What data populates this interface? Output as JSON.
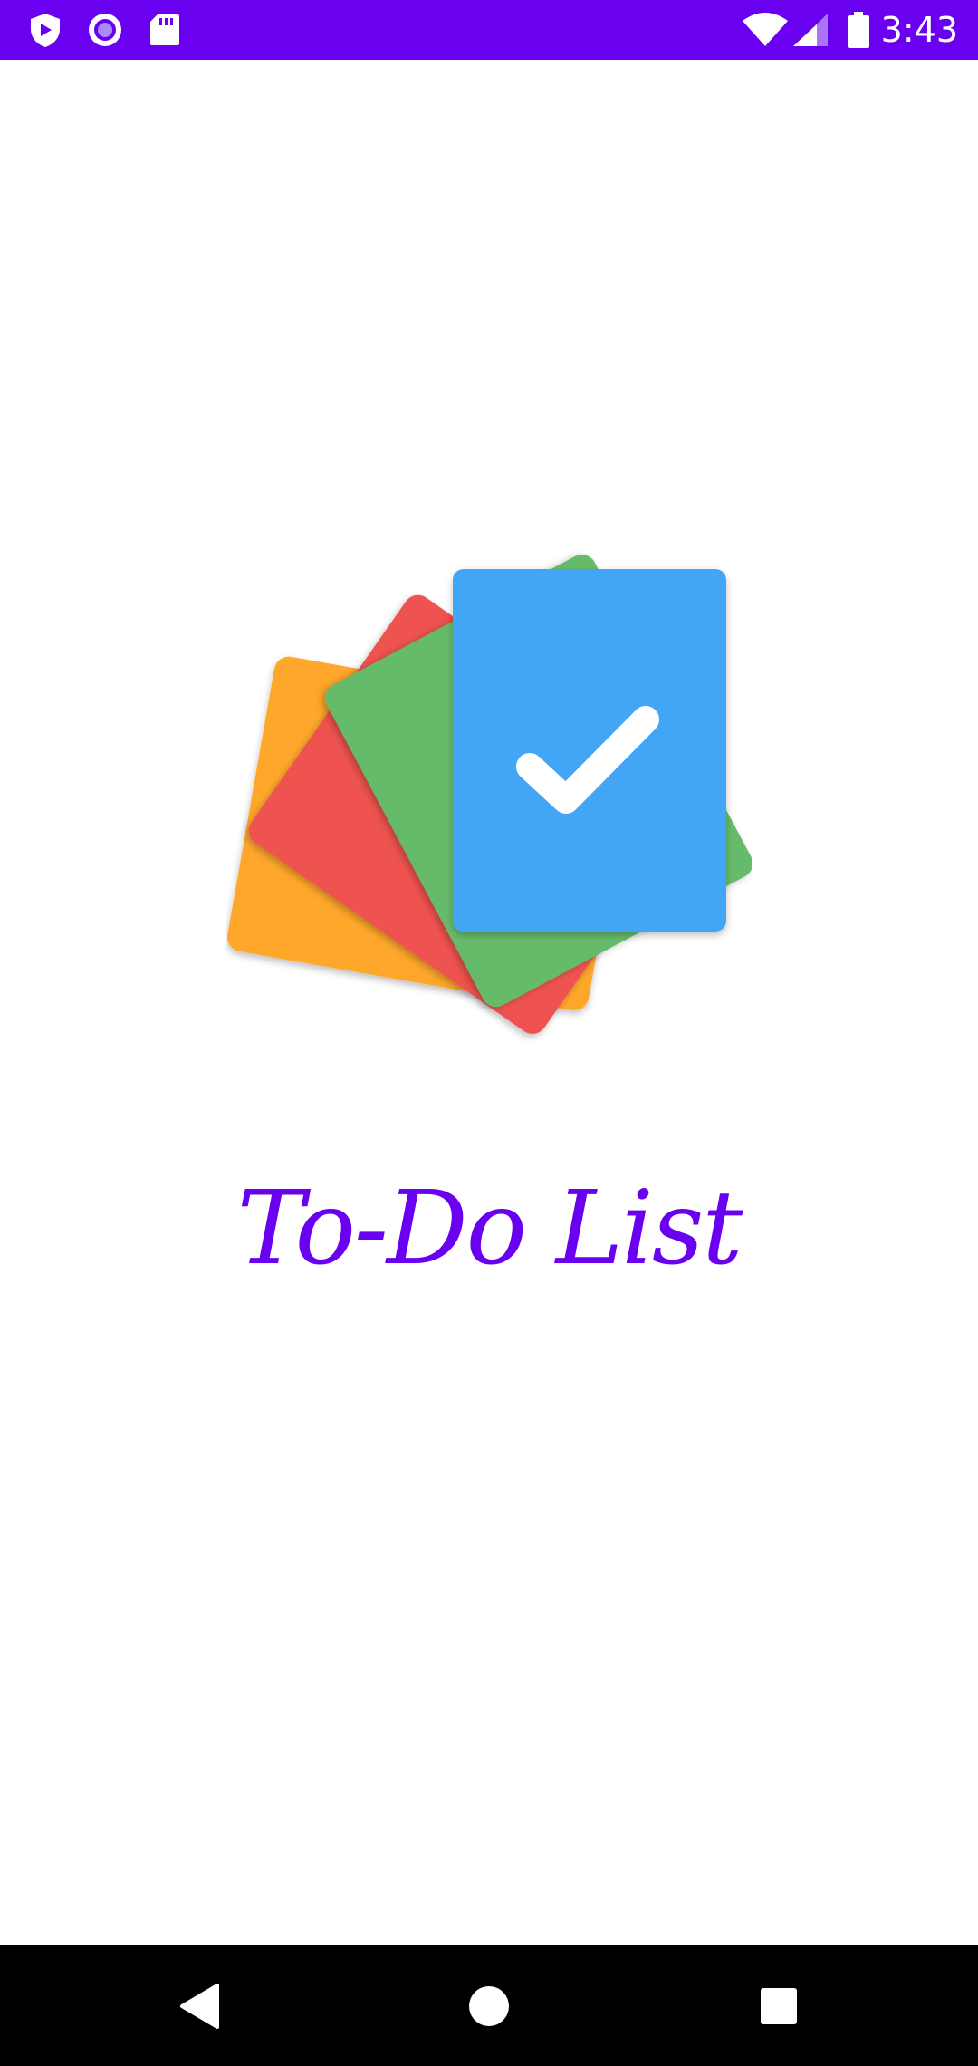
{
  "status_bar": {
    "time": "3:43",
    "left_icons": [
      "shield-play-icon",
      "radio-button-icon",
      "sd-card-icon"
    ],
    "right_icons": [
      "wifi-icon",
      "cell-signal-icon",
      "battery-icon"
    ],
    "background": "#6a00f0"
  },
  "splash": {
    "logo_icon": "stacked-cards-checkmark-icon",
    "title": "To-Do List",
    "title_color": "#6a00f0",
    "card_colors": {
      "orange": "#ffa72a",
      "red": "#ef5350",
      "green": "#66bb6a",
      "blue": "#42a5f5"
    }
  },
  "nav_bar": {
    "buttons": [
      "back-icon",
      "home-icon",
      "recents-icon"
    ]
  }
}
